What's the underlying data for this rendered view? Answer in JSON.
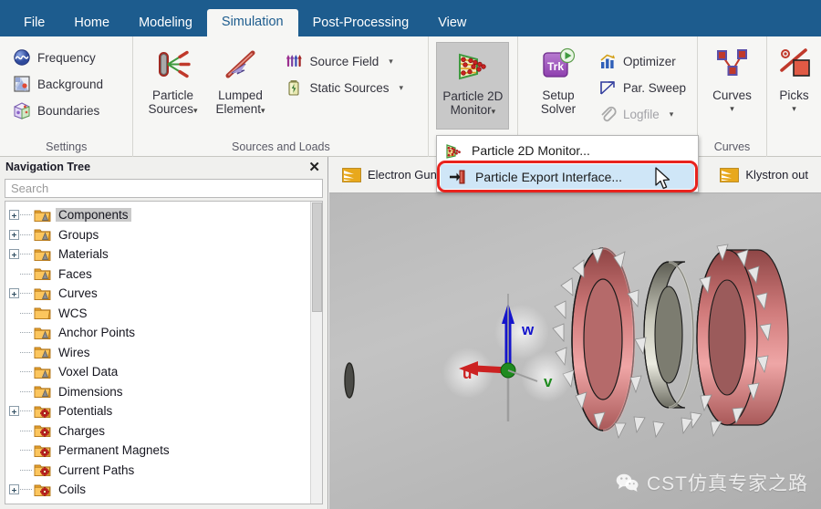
{
  "window": {
    "ribbon_tabs": [
      {
        "label": "File",
        "active": false
      },
      {
        "label": "Home",
        "active": false
      },
      {
        "label": "Modeling",
        "active": false
      },
      {
        "label": "Simulation",
        "active": true
      },
      {
        "label": "Post-Processing",
        "active": false
      },
      {
        "label": "View",
        "active": false
      }
    ],
    "accent_color": "#1d5c8e",
    "highlight_color": "#cfe6f7",
    "outline_color": "#e8231e"
  },
  "ribbon": {
    "groups": [
      {
        "label": "Settings",
        "small_commands": [
          {
            "label": "Frequency",
            "icon": "frequency-icon",
            "caret": false,
            "disabled": false
          },
          {
            "label": "Background",
            "icon": "background-icon",
            "caret": false,
            "disabled": false
          },
          {
            "label": "Boundaries",
            "icon": "boundaries-icon",
            "caret": false,
            "disabled": false
          }
        ]
      },
      {
        "label": "Sources and Loads",
        "big_commands": [
          {
            "label_line1": "Particle",
            "label_line2": "Sources",
            "icon": "particle-sources-icon",
            "caret": true
          },
          {
            "label_line1": "Lumped",
            "label_line2": "Element",
            "icon": "lumped-element-icon",
            "caret": true
          }
        ],
        "small_commands": [
          {
            "label": "Source Field",
            "icon": "source-field-icon",
            "caret": true,
            "disabled": false
          },
          {
            "label": "Static Sources",
            "icon": "static-sources-icon",
            "caret": true,
            "disabled": false
          }
        ]
      },
      {
        "label": "",
        "big_commands": [
          {
            "label_line1": "Particle 2D",
            "label_line2": "Monitor",
            "icon": "particle-2d-monitor-icon",
            "caret": true,
            "selected": true
          }
        ]
      },
      {
        "label": "",
        "big_commands": [
          {
            "label_line1": "Setup",
            "label_line2": "Solver",
            "icon": "setup-solver-icon",
            "caret": false
          }
        ],
        "small_commands": [
          {
            "label": "Optimizer",
            "icon": "optimizer-icon",
            "caret": false,
            "disabled": false
          },
          {
            "label": "Par. Sweep",
            "icon": "par-sweep-icon",
            "caret": false,
            "disabled": false
          },
          {
            "label": "Logfile",
            "icon": "logfile-icon",
            "caret": true,
            "disabled": true
          }
        ]
      },
      {
        "label": "Curves",
        "big_commands": [
          {
            "label_line1": "Curves",
            "label_line2": "",
            "icon": "curves-icon",
            "caret": true
          }
        ]
      },
      {
        "label": "",
        "big_commands": [
          {
            "label_line1": "Picks",
            "label_line2": "",
            "icon": "picks-icon",
            "caret": true
          }
        ]
      }
    ]
  },
  "dropdown": {
    "items": [
      {
        "label": "Particle 2D Monitor...",
        "icon": "particle-2d-monitor-icon",
        "highlighted": false
      },
      {
        "label": "Particle Export Interface...",
        "icon": "particle-export-icon",
        "highlighted": true
      }
    ]
  },
  "navigation": {
    "title": "Navigation Tree",
    "close_label": "✕",
    "search_placeholder": "Search",
    "tree": [
      {
        "label": "Components",
        "expandable": true,
        "icon": "folder-shape-icon",
        "selected": true
      },
      {
        "label": "Groups",
        "expandable": true,
        "icon": "folder-shape-icon",
        "selected": false
      },
      {
        "label": "Materials",
        "expandable": true,
        "icon": "folder-shape-icon",
        "selected": false
      },
      {
        "label": "Faces",
        "expandable": false,
        "icon": "folder-shape-icon",
        "selected": false
      },
      {
        "label": "Curves",
        "expandable": true,
        "icon": "folder-shape-icon",
        "selected": false
      },
      {
        "label": "WCS",
        "expandable": false,
        "icon": "folder-plain-icon",
        "selected": false
      },
      {
        "label": "Anchor Points",
        "expandable": false,
        "icon": "folder-shape-icon",
        "selected": false
      },
      {
        "label": "Wires",
        "expandable": false,
        "icon": "folder-shape-icon",
        "selected": false
      },
      {
        "label": "Voxel Data",
        "expandable": false,
        "icon": "folder-shape-icon",
        "selected": false
      },
      {
        "label": "Dimensions",
        "expandable": false,
        "icon": "folder-shape-icon",
        "selected": false
      },
      {
        "label": "Potentials",
        "expandable": true,
        "icon": "folder-gear-icon",
        "selected": false
      },
      {
        "label": "Charges",
        "expandable": false,
        "icon": "folder-gear-icon",
        "selected": false
      },
      {
        "label": "Permanent Magnets",
        "expandable": false,
        "icon": "folder-gear-icon",
        "selected": false
      },
      {
        "label": "Current Paths",
        "expandable": false,
        "icon": "folder-gear-icon",
        "selected": false
      },
      {
        "label": "Coils",
        "expandable": true,
        "icon": "folder-gear-icon",
        "selected": false
      }
    ]
  },
  "doctabs": [
    {
      "label": "Electron Gun",
      "icon": "project-icon"
    },
    {
      "label": "Klystron out",
      "icon": "project-icon"
    }
  ],
  "viewport": {
    "axis_labels": {
      "u": "u",
      "v": "v",
      "w": "w"
    },
    "axis_colors": {
      "u": "#cc2222",
      "v": "#1f8b1f",
      "w": "#1515cc"
    },
    "watermark_text": "CST仿真专家之路"
  }
}
